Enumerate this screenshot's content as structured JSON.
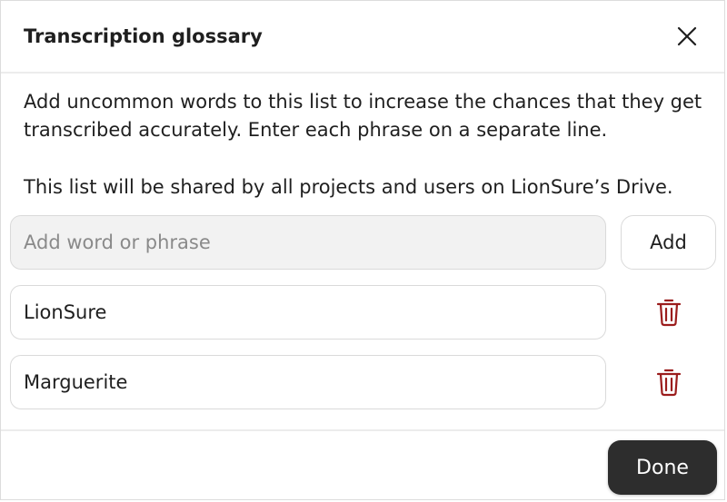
{
  "dialog": {
    "title": "Transcription glossary",
    "close_icon": "close-icon",
    "description": "Add uncommon words to this list to increase the chances that they get transcribed accurately. Enter each phrase on a separate line.",
    "shared_note": "This list will be shared by all projects and users on LionSure’s Drive."
  },
  "add_form": {
    "input_value": "",
    "placeholder": "Add word or phrase",
    "add_label": "Add"
  },
  "glossary": {
    "items": [
      {
        "text": "LionSure",
        "delete_icon": "trash-icon"
      },
      {
        "text": "Marguerite",
        "delete_icon": "trash-icon"
      }
    ]
  },
  "footer": {
    "done_label": "Done"
  },
  "colors": {
    "trash": "#9b1c1c",
    "done_bg": "#2d2d2d",
    "input_bg": "#f2f2f2"
  }
}
